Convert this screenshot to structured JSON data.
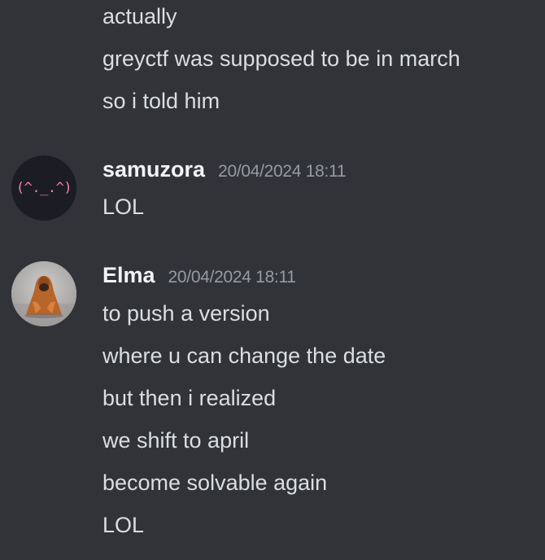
{
  "messages_top": [
    "actually",
    "greyctf was supposed to be in march",
    "so i told him"
  ],
  "samuzora": {
    "avatar_text": "(^._.^)",
    "username": "samuzora",
    "timestamp": "20/04/2024 18:11",
    "lines": [
      "LOL"
    ]
  },
  "elma": {
    "username": "Elma",
    "timestamp": "20/04/2024 18:11",
    "lines": [
      "to push a version",
      "where u can change the date",
      "but then i realized",
      "we shift to april",
      "become solvable again",
      "LOL"
    ]
  },
  "colors": {
    "background": "#313338",
    "text": "#dbdee1",
    "username": "#f2f3f5",
    "timestamp": "#949ba4",
    "kaomoji": "#f47fb0"
  }
}
